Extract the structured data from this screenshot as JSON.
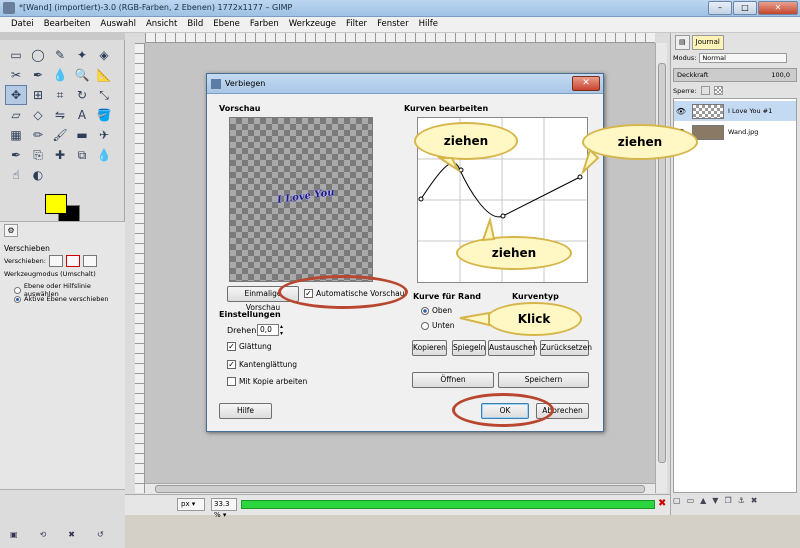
{
  "window": {
    "title": "*[Wand] (importiert)-3.0 (RGB-Farben, 2 Ebenen) 1772x1177 – GIMP",
    "minimize": "–",
    "maximize": "□",
    "close": "✕"
  },
  "menu": [
    "Datei",
    "Bearbeiten",
    "Auswahl",
    "Ansicht",
    "Bild",
    "Ebene",
    "Farben",
    "Werkzeuge",
    "Filter",
    "Fenster",
    "Hilfe"
  ],
  "toolbox": {
    "tools": [
      "rect-select",
      "ellipse-select",
      "lasso",
      "fuzzy-select",
      "color-select",
      "scissors",
      "paths",
      "color-picker",
      "zoom",
      "measure",
      "move",
      "align",
      "crop",
      "rotate",
      "scale",
      "shear",
      "perspective",
      "flip",
      "text",
      "bucket-fill",
      "blend",
      "pencil",
      "paintbrush",
      "eraser",
      "airbrush",
      "ink",
      "clone",
      "heal",
      "perspective-clone",
      "blur",
      "smudge",
      "dodge-burn"
    ],
    "selected_tool": "move",
    "fg_color": "#ffff00",
    "bg_color": "#000000",
    "options": {
      "title": "Verschieben",
      "verschieben_label": "Verschieben:",
      "mode_label": "Werkzeugmodus (Umschalt)",
      "radio1": "Ebene oder Hilfslinie auswählen",
      "radio2": "Aktive Ebene verschieben"
    }
  },
  "status": {
    "unit": "px ▾",
    "zoom": "33.3 % ▾",
    "progress": 1.0
  },
  "layers_panel": {
    "tab_journal": "Journal",
    "modus_label": "Modus:",
    "modus_value": "Normal",
    "deckkraft_label": "Deckkraft",
    "deckkraft_value": "100,0",
    "sperre_label": "Sperre:",
    "layers": [
      {
        "name": "I Love You #1",
        "selected": true
      },
      {
        "name": "Wand.jpg",
        "selected": false
      }
    ]
  },
  "dialog": {
    "title": "Verbiegen",
    "close": "✕",
    "vorschau": "Vorschau",
    "preview_text": "I Love You",
    "einmalige": "Einmalige Vorschau",
    "automatische": "Automatische Vorschau",
    "automatische_checked": true,
    "einstellungen": "Einstellungen",
    "drehen_label": "Drehen:",
    "drehen_value": "0,0",
    "glaettung": "Glättung",
    "kantenglaettung": "Kantenglättung",
    "mit_kopie": "Mit Kopie arbeiten",
    "glaettung_checked": true,
    "kantenglaettung_checked": true,
    "mit_kopie_checked": false,
    "kurven_title": "Kurven bearbeiten",
    "kurve_fuer_rand": "Kurve für Rand",
    "kurventyp": "Kurventyp",
    "oben": "Oben",
    "unten": "Unten",
    "oben_selected": true,
    "kopieren": "Kopieren",
    "spiegeln": "Spiegeln",
    "austauschen": "Austauschen",
    "zuruecksetzen": "Zurücksetzen",
    "oeffnen": "Öffnen",
    "speichern": "Speichern",
    "hilfe": "Hilfe",
    "ok": "OK",
    "abbrechen": "Abbrechen"
  },
  "annotations": {
    "ziehen1": "ziehen",
    "ziehen2": "ziehen",
    "ziehen3": "ziehen",
    "klick": "Klick",
    "bubble_fill": "#fff8c4",
    "bubble_border": "#d6b54a",
    "ring_color": "#b9472f"
  }
}
